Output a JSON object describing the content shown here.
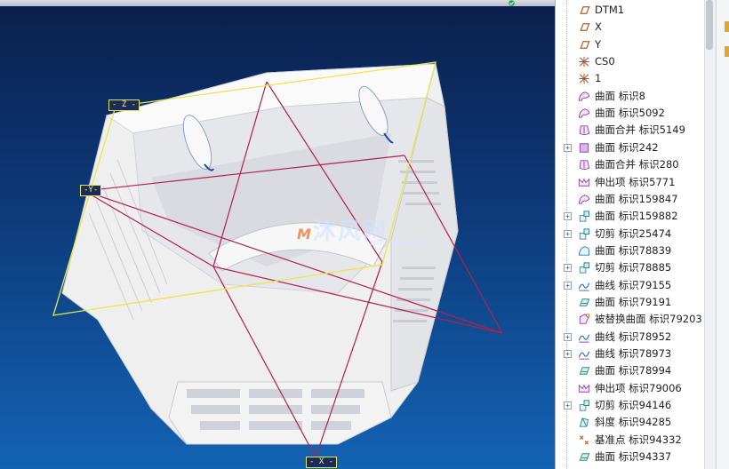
{
  "viewport": {
    "colors": {
      "datum_plane": "#e8e84a",
      "reference_line": "#b02050",
      "model": "#f4f4f4"
    },
    "plane_labels": [
      {
        "id": "z",
        "text": "- Z -"
      },
      {
        "id": "y",
        "text": "-Y-"
      },
      {
        "id": "x",
        "text": "- X -"
      }
    ],
    "watermark": {
      "logo": "M",
      "main": "沐风网",
      "sub": "mfcad.com"
    }
  },
  "model_tree": {
    "items": [
      {
        "label": "DTM1",
        "icon": "datum-plane-icon",
        "expandable": false
      },
      {
        "label": "X",
        "icon": "datum-plane-icon",
        "expandable": false
      },
      {
        "label": "Y",
        "icon": "datum-plane-icon",
        "expandable": false
      },
      {
        "label": "CS0",
        "icon": "coordinate-system-icon",
        "expandable": false
      },
      {
        "label": "1",
        "icon": "coordinate-system-icon",
        "expandable": false
      },
      {
        "label": "曲面 标识8",
        "icon": "surface-icon",
        "expandable": false
      },
      {
        "label": "曲面 标识5092",
        "icon": "surface-icon",
        "expandable": false
      },
      {
        "label": "曲面合并 标识5149",
        "icon": "merge-icon",
        "expandable": false
      },
      {
        "label": "曲面 标识242",
        "icon": "surface-box-icon",
        "expandable": true
      },
      {
        "label": "曲面合并 标识280",
        "icon": "merge-icon",
        "expandable": false
      },
      {
        "label": "伸出项 标识5771",
        "icon": "protrusion-icon",
        "expandable": false
      },
      {
        "label": "曲面 标识159847",
        "icon": "surface-icon",
        "expandable": false
      },
      {
        "label": "曲面 标识159882",
        "icon": "cut-icon",
        "expandable": true
      },
      {
        "label": "切剪 标识25474",
        "icon": "cut-icon",
        "expandable": true
      },
      {
        "label": "曲面 标识78839",
        "icon": "surface-blue-icon",
        "expandable": false
      },
      {
        "label": "切剪 标识78885",
        "icon": "cut-icon",
        "expandable": true
      },
      {
        "label": "曲线 标识79155",
        "icon": "curve-icon",
        "expandable": true
      },
      {
        "label": "曲面 标识79191",
        "icon": "surface-teal-icon",
        "expandable": false
      },
      {
        "label": "被替换曲面 标识79203",
        "icon": "replaced-surface-icon",
        "expandable": false
      },
      {
        "label": "曲线 标识78952",
        "icon": "curve-icon",
        "expandable": true
      },
      {
        "label": "曲线 标识78973",
        "icon": "curve-icon",
        "expandable": true
      },
      {
        "label": "曲面 标识78994",
        "icon": "surface-teal-icon",
        "expandable": false
      },
      {
        "label": "伸出项 标识79006",
        "icon": "protrusion-icon",
        "expandable": false
      },
      {
        "label": "切剪 标识94146",
        "icon": "cut-icon",
        "expandable": true
      },
      {
        "label": "斜度 标识94285",
        "icon": "draft-icon",
        "expandable": false
      },
      {
        "label": "基准点 标识94332",
        "icon": "datum-point-icon",
        "expandable": false
      },
      {
        "label": "曲面 标识94337",
        "icon": "surface-teal-icon",
        "expandable": false
      }
    ]
  }
}
